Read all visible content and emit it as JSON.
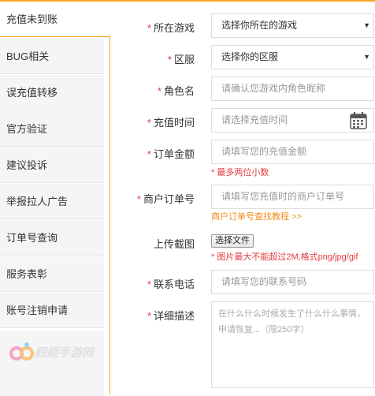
{
  "sidebar": {
    "items": [
      {
        "label": "充值未到账"
      },
      {
        "label": "BUG相关"
      },
      {
        "label": "误充值转移"
      },
      {
        "label": "官方验证"
      },
      {
        "label": "建议投诉"
      },
      {
        "label": "举报拉人广告"
      },
      {
        "label": "订单号查询"
      },
      {
        "label": "服务表彰"
      },
      {
        "label": "账号注销申请"
      }
    ],
    "logo_text": "超超手游网"
  },
  "form": {
    "required_mark": "*",
    "game": {
      "label": "所在游戏",
      "value": "选择你所在的游戏"
    },
    "server": {
      "label": "区服",
      "value": "选择你的区服"
    },
    "role": {
      "label": "角色名",
      "placeholder": "请确认您游戏内角色昵称"
    },
    "time": {
      "label": "充值时间",
      "placeholder": "请选择充值时间"
    },
    "amount": {
      "label": "订单金额",
      "placeholder": "请填写您的充值金额",
      "hint": "* 最多两位小数"
    },
    "merchant": {
      "label": "商户订单号",
      "placeholder": "请填写您充值时的商户订单号",
      "link": "商户订单号查找教程 >>"
    },
    "upload": {
      "label": "上传截图",
      "button": "选择文件",
      "hint": "* 图片最大不能超过2M,格式png/jpg/gif"
    },
    "phone": {
      "label": "联系电话",
      "placeholder": "请填写您的联系号码"
    },
    "detail": {
      "label": "详细描述",
      "placeholder": "在什么什么时候发生了什么什么事情，申请恢复...（限250字）"
    }
  },
  "colors": {
    "accent": "#f5a623",
    "required": "#e4393c",
    "link": "#f08c1e"
  }
}
